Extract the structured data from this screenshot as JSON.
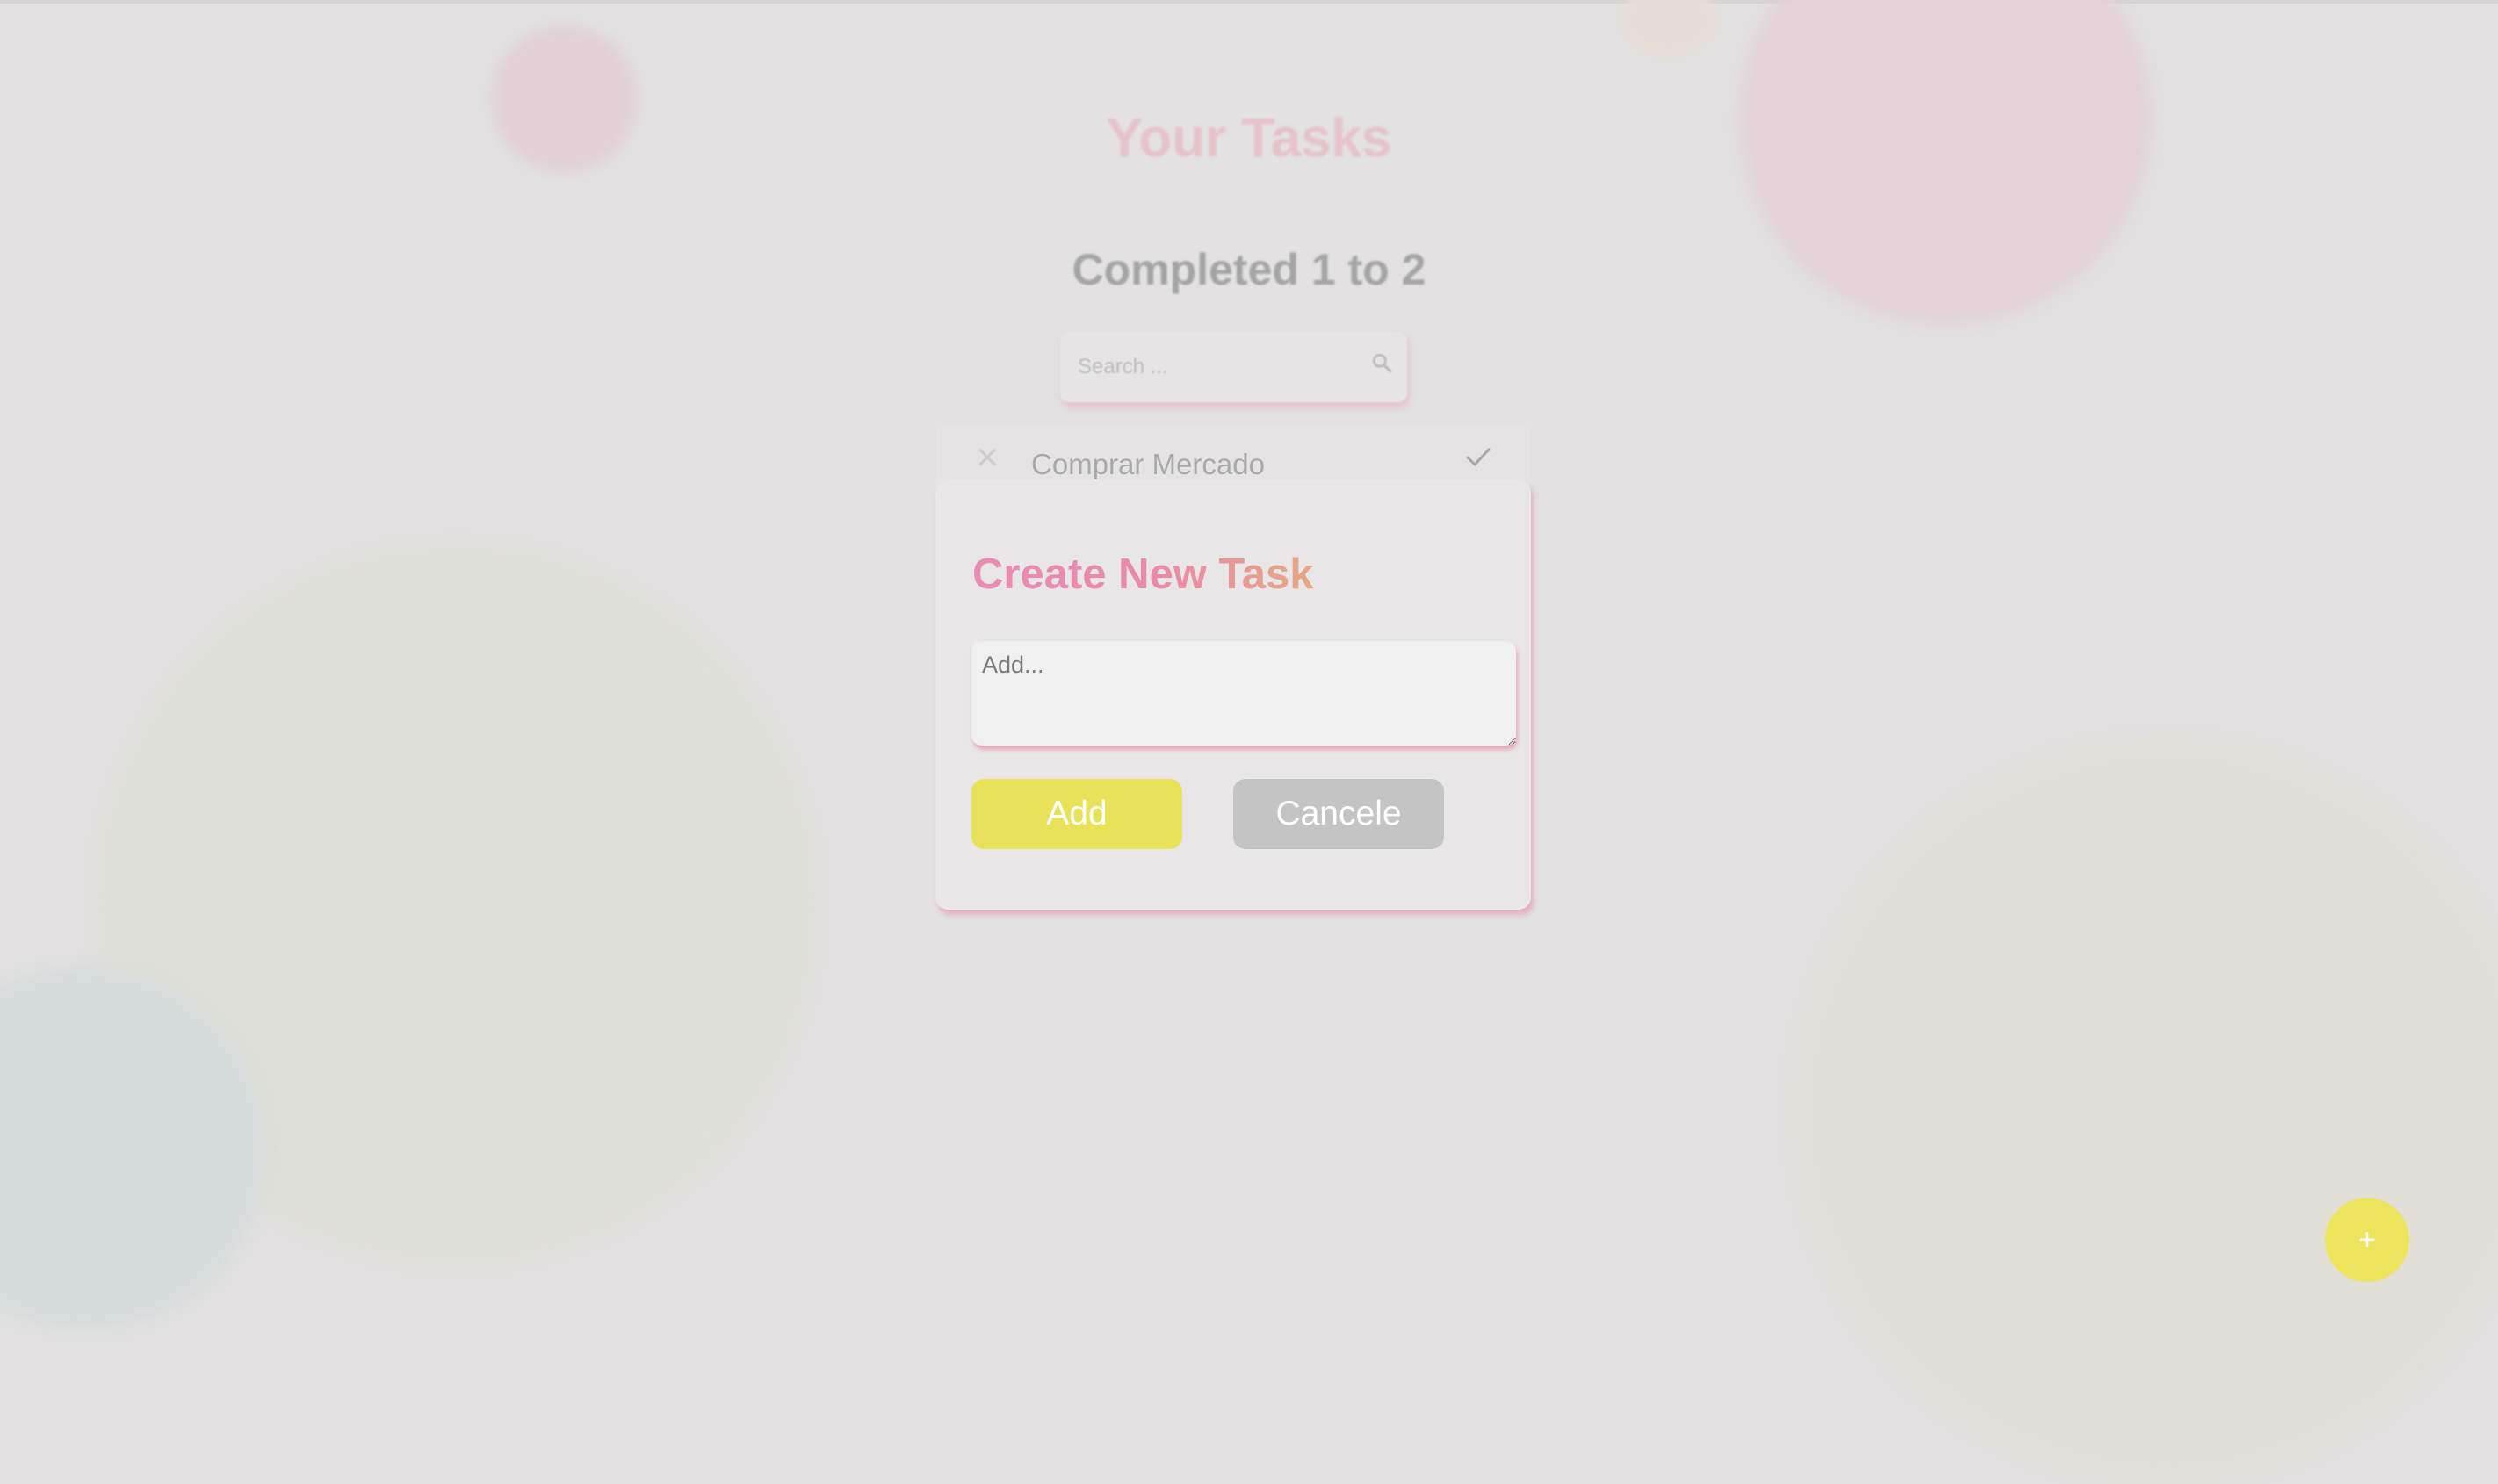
{
  "page": {
    "title": "Your Tasks",
    "subtitle": "Completed 1 to 2"
  },
  "search": {
    "placeholder": "Search ...",
    "icon": "search-icon"
  },
  "tasks": [
    {
      "label": "Comprar Mercado",
      "remove_icon": "close-icon",
      "done_icon": "check-icon"
    }
  ],
  "modal": {
    "title": "Create New Task",
    "input_placeholder": "Add...",
    "input_value": "",
    "add_label": "Add",
    "cancel_label": "Cancele"
  },
  "fab": {
    "label": "+"
  },
  "colors": {
    "accent_yellow": "#e8e25a",
    "cancel_gray": "#c4c4c4",
    "title_gradient_start": "#ea8cb4",
    "title_gradient_end": "#e6a882",
    "shadow_pink": "#e6a0b4"
  }
}
